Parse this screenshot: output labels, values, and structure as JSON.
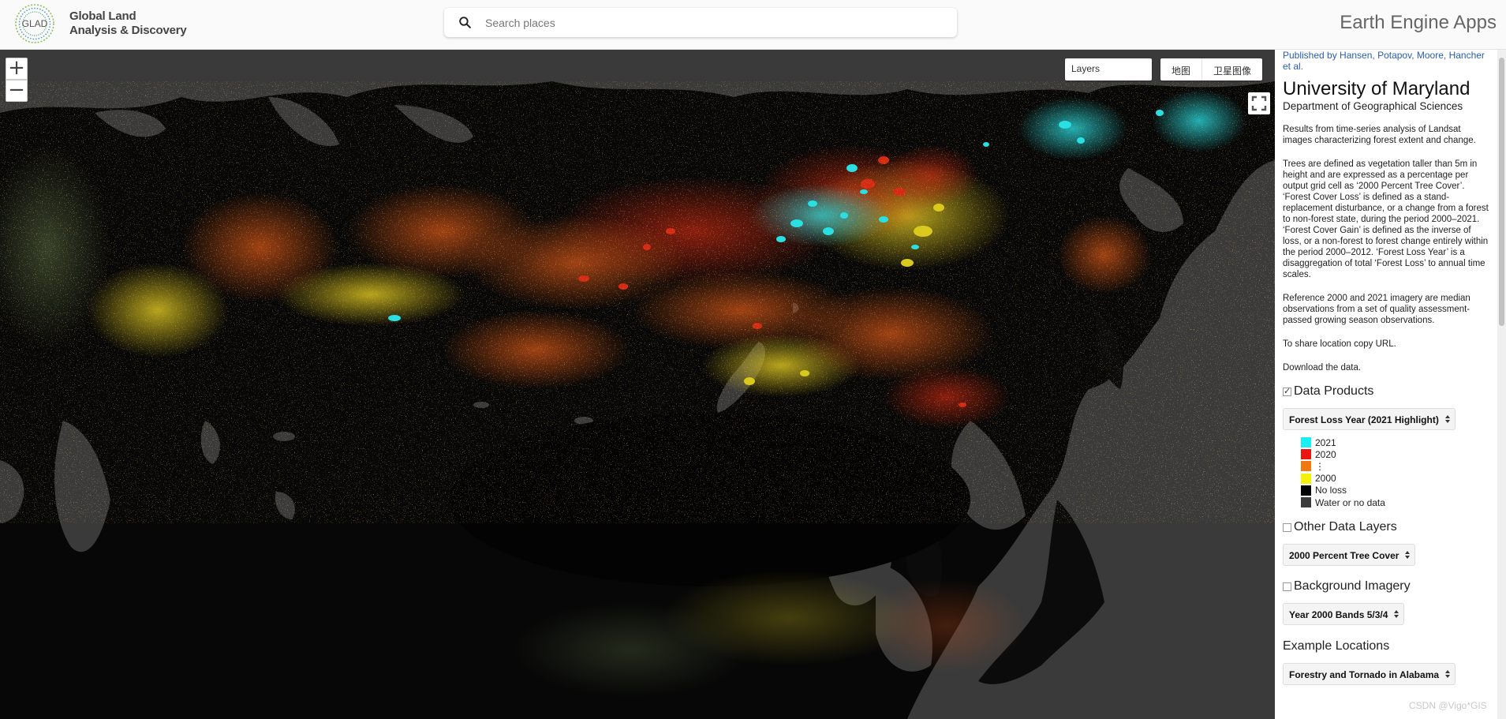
{
  "header": {
    "logo_text": "GLAD",
    "brand_line1": "Global Land",
    "brand_line2": "Analysis & Discovery",
    "search_placeholder": "Search places",
    "app_title": "Earth Engine Apps"
  },
  "map": {
    "layers_label": "Layers",
    "map_type_map": "地图",
    "map_type_satellite": "卫星图像",
    "zoom_in": "+",
    "zoom_out": "−",
    "colors": {
      "water": "#3a3a3a",
      "land": "#070707"
    }
  },
  "sidebar": {
    "published": "Published by Hansen, Potapov, Moore, Hancher et al.",
    "org_title": "University of Maryland",
    "department": "Department of Geographical Sciences",
    "paragraphs": [
      "Results from time-series analysis of Landsat images characterizing forest extent and change.",
      "Trees are defined as vegetation taller than 5m in height and are expressed as a percentage per output grid cell as ‘2000 Percent Tree Cover’. ‘Forest Cover Loss’ is defined as a stand-replacement disturbance, or a change from a forest to non-forest state, during the period 2000–2021. ‘Forest Cover Gain’ is defined as the inverse of loss, or a non-forest to forest change entirely within the period 2000–2012. ‘Forest Loss Year’ is a disaggregation of total ‘Forest Loss’ to annual time scales.",
      "Reference 2000 and 2021 imagery are median observations from a set of quality assessment-passed growing season observations.",
      "To share location copy URL.",
      "Download the data."
    ],
    "data_products": {
      "label": "Data Products",
      "checked": true,
      "select": "Forest Loss Year (2021 Highlight)",
      "legend": [
        {
          "label": "2021",
          "color": "#19f0f0"
        },
        {
          "label": "2020",
          "color": "#e8170f"
        },
        {
          "label": "⋮",
          "color": "#f07a10"
        },
        {
          "label": "2000",
          "color": "#f5f00a"
        },
        {
          "label": "No loss",
          "color": "#000000"
        },
        {
          "label": "Water or no data",
          "color": "#3b3b3b"
        }
      ]
    },
    "other_layers": {
      "label": "Other Data Layers",
      "checked": false,
      "select": "2000 Percent Tree Cover"
    },
    "background": {
      "label": "Background Imagery",
      "checked": false,
      "select": "Year 2000 Bands 5/3/4"
    },
    "examples": {
      "label": "Example Locations",
      "select": "Forestry and Tornado in Alabama"
    }
  },
  "watermark": "CSDN @Vigo*GIS"
}
